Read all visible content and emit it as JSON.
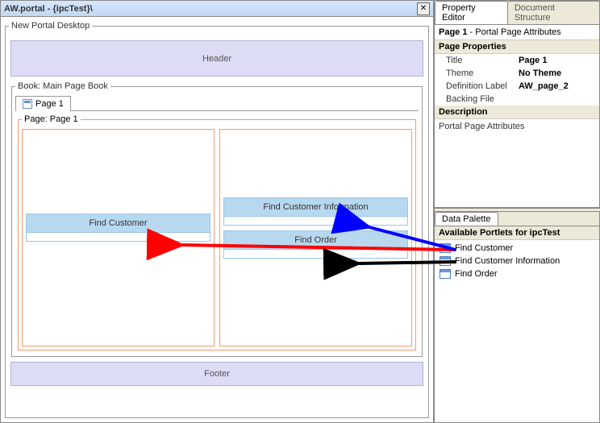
{
  "editor": {
    "title": "AW.portal - {ipcTest}\\",
    "desktop_legend": "New Portal Desktop",
    "header_label": "Header",
    "footer_label": "Footer",
    "book_legend": "Book: Main Page Book",
    "tab1_label": "Page 1",
    "page_legend": "Page: Page 1",
    "portlets": {
      "left": "Find Customer",
      "right1": "Find Customer Information",
      "right2": "Find Order"
    }
  },
  "prop_editor": {
    "tab_active": "Property Editor",
    "tab_inactive": "Document Structure",
    "heading_bold": "Page 1",
    "heading_rest": " - Portal Page Attributes",
    "section1": "Page Properties",
    "rows": {
      "title_k": "Title",
      "title_v": "Page 1",
      "theme_k": "Theme",
      "theme_v": "No Theme",
      "deflabel_k": "Definition Label",
      "deflabel_v": "AW_page_2",
      "backing_k": "Backing File",
      "backing_v": ""
    },
    "section2": "Description",
    "desc_body": "Portal Page Attributes"
  },
  "palette": {
    "tab": "Data Palette",
    "section": "Available Portlets for ipcTest",
    "items": {
      "p1": "Find Customer",
      "p2": "Find Customer Information",
      "p3": "Find Order"
    }
  }
}
